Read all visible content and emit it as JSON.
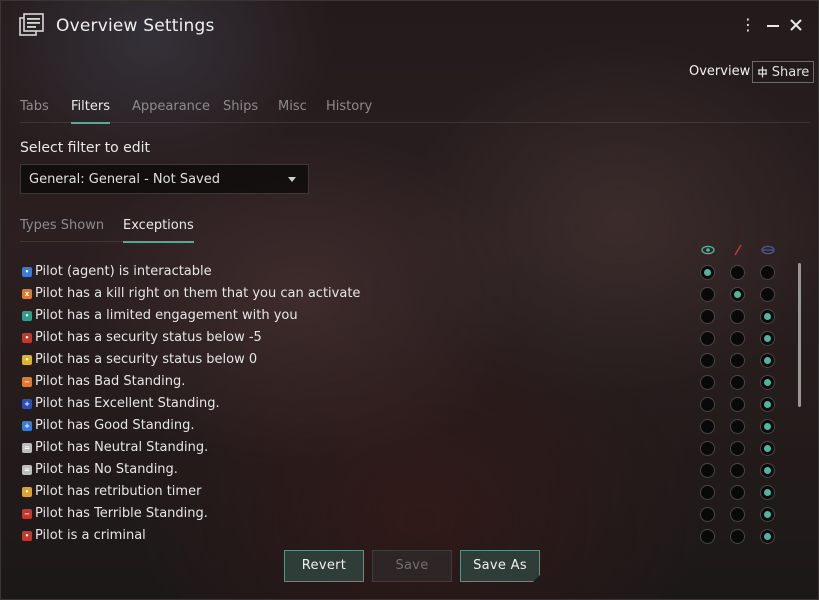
{
  "window": {
    "title": "Overview Settings",
    "menu_icon": "kebab-menu-icon",
    "minimize_icon": "minimize-icon",
    "close_icon": "close-icon"
  },
  "top_links": {
    "overview": "Overview",
    "share": "Share"
  },
  "tabs": [
    {
      "label": "Tabs",
      "active": false
    },
    {
      "label": "Filters",
      "active": true
    },
    {
      "label": "Appearance",
      "active": false
    },
    {
      "label": "Ships",
      "active": false
    },
    {
      "label": "Misc",
      "active": false
    },
    {
      "label": "History",
      "active": false
    }
  ],
  "filter": {
    "label": "Select filter to edit",
    "selected": "General: General - Not Saved"
  },
  "sub_tabs": [
    {
      "label": "Types Shown",
      "active": false
    },
    {
      "label": "Exceptions",
      "active": true
    }
  ],
  "columns": [
    {
      "icon": "eye-icon",
      "color": "#4fb59e"
    },
    {
      "icon": "slash-icon",
      "color": "#c0392b"
    },
    {
      "icon": "eye-closed-icon",
      "color": "#4a5a9a"
    }
  ],
  "rows": [
    {
      "label": "Pilot (agent) is interactable",
      "icon_color": "#3a7bd5",
      "glyph": "•",
      "selected": 0
    },
    {
      "label": "Pilot has a kill right on them that you can activate",
      "icon_color": "#e07a30",
      "glyph": "x",
      "selected": 1
    },
    {
      "label": "Pilot has a limited engagement with you",
      "icon_color": "#2e9d8a",
      "glyph": "•",
      "selected": 2
    },
    {
      "label": "Pilot has a security status below -5",
      "icon_color": "#c0392b",
      "glyph": "•",
      "selected": 2
    },
    {
      "label": "Pilot has a security status below 0",
      "icon_color": "#e0b030",
      "glyph": "•",
      "selected": 2
    },
    {
      "label": "Pilot has Bad Standing.",
      "icon_color": "#e07a30",
      "glyph": "−",
      "selected": 2
    },
    {
      "label": "Pilot has Excellent Standing.",
      "icon_color": "#2a4fb5",
      "glyph": "+",
      "selected": 2
    },
    {
      "label": "Pilot has Good Standing.",
      "icon_color": "#3a7bd5",
      "glyph": "+",
      "selected": 2
    },
    {
      "label": "Pilot has Neutral Standing.",
      "icon_color": "#bdbdbd",
      "glyph": "=",
      "selected": 2
    },
    {
      "label": "Pilot has No Standing.",
      "icon_color": "#bdbdbd",
      "glyph": "=",
      "selected": 2
    },
    {
      "label": "Pilot has retribution timer",
      "icon_color": "#e0a030",
      "glyph": "•",
      "selected": 2
    },
    {
      "label": "Pilot has Terrible Standing.",
      "icon_color": "#c0392b",
      "glyph": "−",
      "selected": 2
    },
    {
      "label": "Pilot is a criminal",
      "icon_color": "#c0392b",
      "glyph": "•",
      "selected": 2
    }
  ],
  "buttons": {
    "revert": "Revert",
    "save": "Save",
    "save_as": "Save As"
  }
}
